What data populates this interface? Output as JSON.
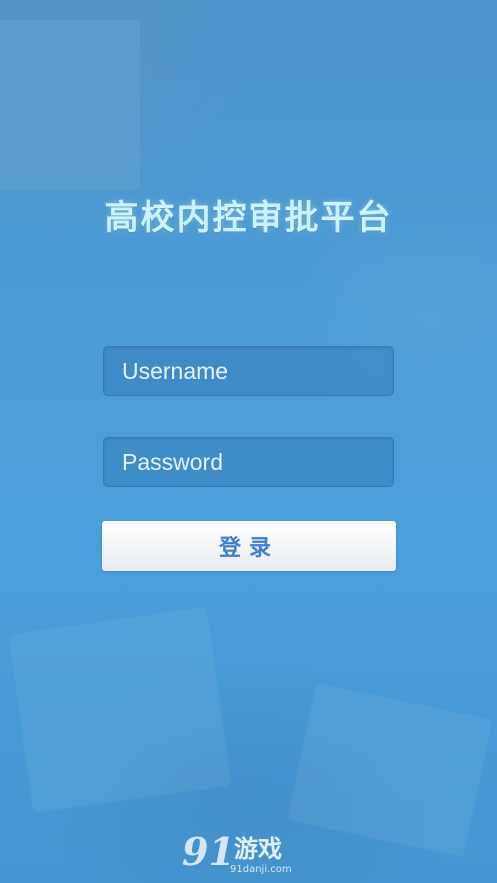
{
  "app": {
    "title": "高校内控审批平台"
  },
  "login_form": {
    "username_placeholder": "Username",
    "password_placeholder": "Password",
    "login_label": "登录"
  },
  "watermark": {
    "logo_text": "91",
    "name": "游戏",
    "url": "91danji.com"
  },
  "colors": {
    "background": "#4a9ad4",
    "title": "#c9f4ff",
    "button_text": "#3f7fd0"
  }
}
